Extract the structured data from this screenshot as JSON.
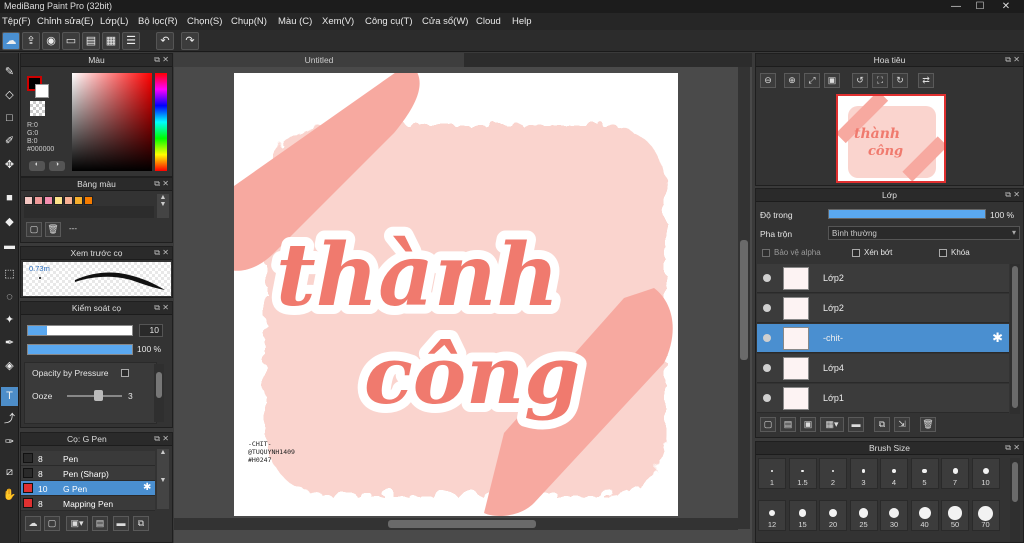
{
  "window": {
    "title": "MediBang Paint Pro (32bit)",
    "minimize": "—",
    "maximize": "☐",
    "close": "✕"
  },
  "menu": [
    "Tệp(F)",
    "Chỉnh sửa(E)",
    "Lớp(L)",
    "Bộ lọc(R)",
    "Chọn(S)",
    "Chụp(N)",
    "Màu (C)",
    "Xem(V)",
    "Công cụ(T)",
    "Cửa sổ(W)",
    "Cloud",
    "Help"
  ],
  "color_panel": {
    "title": "Màu",
    "r": "R:0",
    "g": "G:0",
    "b": "B:0",
    "hex": "#000000",
    "fg_color": "#000000",
    "bg_color": "#ffffff",
    "hint_color": "#cc0000"
  },
  "palette_panel": {
    "title": "Bảng màu",
    "swatches": [
      "#f4c7c3",
      "#ef9a9a",
      "#f48fb1",
      "#fce38a",
      "#f8b195",
      "#f6ae2d",
      "#f57c00"
    ],
    "dropdown": "---"
  },
  "brush_preview": {
    "title": "Xem trước cọ",
    "size": "0.73m"
  },
  "brush_control": {
    "title": "Kiểm soát cọ",
    "size_value": "10",
    "opacity_value": "100 %",
    "opacity_pressure_label": "Opacity by Pressure",
    "ooze_label": "Ooze",
    "ooze_value": "3"
  },
  "brush_list": {
    "title": "Cọ: G Pen",
    "items": [
      {
        "size": "8",
        "name": "Pen",
        "color": "#2a2a2a"
      },
      {
        "size": "8",
        "name": "Pen (Sharp)",
        "color": "#2a2a2a"
      },
      {
        "size": "10",
        "name": "G Pen",
        "color": "#e03030"
      },
      {
        "size": "8",
        "name": "Mapping Pen",
        "color": "#e03030"
      }
    ]
  },
  "document": {
    "tab": "Untitled"
  },
  "artwork": {
    "line1": "thành",
    "line2": "công",
    "credit": [
      "-CHIT-",
      "@TUQUYNH1409",
      "#H0247"
    ]
  },
  "navigator": {
    "title": "Hoa tiêu"
  },
  "layer_panel": {
    "title": "Lớp",
    "opacity_label": "Độ trong",
    "opacity_value": "100 %",
    "opacity_fraction": 1.0,
    "blend_label": "Pha trộn",
    "blend_value": "Bình thường",
    "protect_alpha": "Bảo vệ alpha",
    "clipping": "Xén bớt",
    "lock": "Khóa",
    "layers": [
      {
        "name": "Lớp2",
        "selected": false
      },
      {
        "name": "Lớp2",
        "selected": false
      },
      {
        "name": "-chit-",
        "selected": true
      },
      {
        "name": "Lớp4",
        "selected": false
      },
      {
        "name": "Lớp1",
        "selected": false
      }
    ]
  },
  "brush_size_panel": {
    "title": "Brush Size",
    "row1": [
      "1",
      "1.5",
      "2",
      "3",
      "4",
      "5",
      "7",
      "10"
    ],
    "row2": [
      "12",
      "15",
      "20",
      "25",
      "30",
      "40",
      "50",
      "70"
    ]
  },
  "colors": {
    "accent": "#4a8fd0",
    "peach": "#f7a9a0",
    "pink_blob": "#fad4ce",
    "text_coral": "#f07a6e"
  }
}
